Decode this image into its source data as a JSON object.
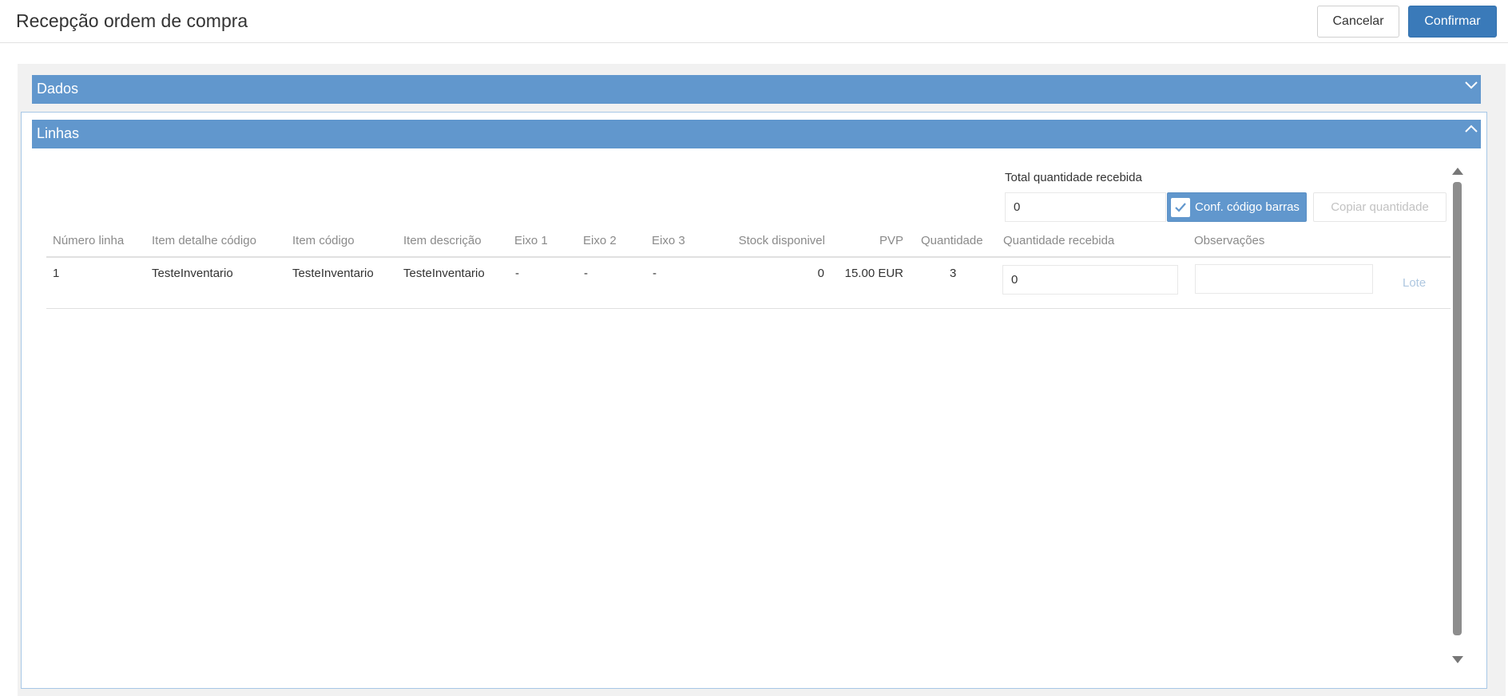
{
  "header": {
    "title": "Recepção ordem de compra",
    "cancel_label": "Cancelar",
    "confirm_label": "Confirmar"
  },
  "panels": {
    "dados": {
      "title": "Dados",
      "icon": "chevron-down-icon"
    },
    "linhas": {
      "title": "Linhas",
      "icon": "chevron-up-icon"
    }
  },
  "toolbar": {
    "total_label": "Total quantidade recebida",
    "total_value": "0",
    "barcode_label": "Conf. código barras",
    "barcode_checked": true,
    "copy_label": "Copiar quantidade"
  },
  "table": {
    "columns": [
      "Número linha",
      "Item detalhe código",
      "Item código",
      "Item descrição",
      "Eixo 1",
      "Eixo 2",
      "Eixo 3",
      "Stock disponivel",
      "PVP",
      "Quantidade",
      "Quantidade recebida",
      "Observações"
    ],
    "rows": [
      {
        "numero_linha": "1",
        "item_detalhe_codigo": "TesteInventario",
        "item_codigo": "TesteInventario",
        "item_descricao": "TesteInventario",
        "eixo1": "-",
        "eixo2": "-",
        "eixo3": "-",
        "stock_disponivel": "0",
        "pvp": "15.00 EUR",
        "quantidade": "3",
        "quantidade_recebida": "0",
        "observacoes": "",
        "lote_label": "Lote"
      }
    ]
  },
  "colors": {
    "panel_header": "#6197cd",
    "confirm_button": "#3a7ab9",
    "panel_border": "#a7c7e6"
  }
}
